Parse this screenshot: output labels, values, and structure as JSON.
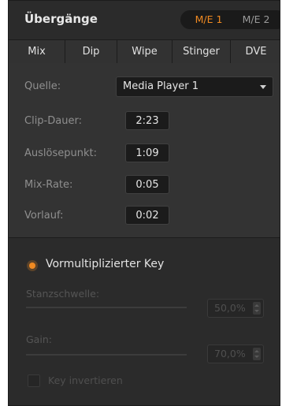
{
  "header": {
    "title": "Übergänge",
    "me_buttons": [
      {
        "label": "M/E 1",
        "active": true
      },
      {
        "label": "M/E 2",
        "active": false
      }
    ]
  },
  "tabs": [
    {
      "label": "Mix"
    },
    {
      "label": "Dip"
    },
    {
      "label": "Wipe"
    },
    {
      "label": "Stinger",
      "selected": true
    },
    {
      "label": "DVE"
    }
  ],
  "stinger": {
    "source_label": "Quelle:",
    "source_value": "Media Player 1",
    "clip_duration_label": "Clip-Dauer:",
    "clip_duration_value": "2:23",
    "trigger_label": "Auslösepunkt:",
    "trigger_value": "1:09",
    "mix_rate_label": "Mix-Rate:",
    "mix_rate_value": "0:05",
    "preroll_label": "Vorlauf:",
    "preroll_value": "0:02"
  },
  "key": {
    "label": "Vormultiplizierter Key",
    "enabled": true,
    "clip_label": "Stanzschwelle:",
    "clip_value": "50,0%",
    "gain_label": "Gain:",
    "gain_value": "70,0%",
    "invert_label": "Key invertieren",
    "invert_checked": false
  },
  "colors": {
    "accent": "#f08a22",
    "panel_bg": "#2b2b2b"
  }
}
